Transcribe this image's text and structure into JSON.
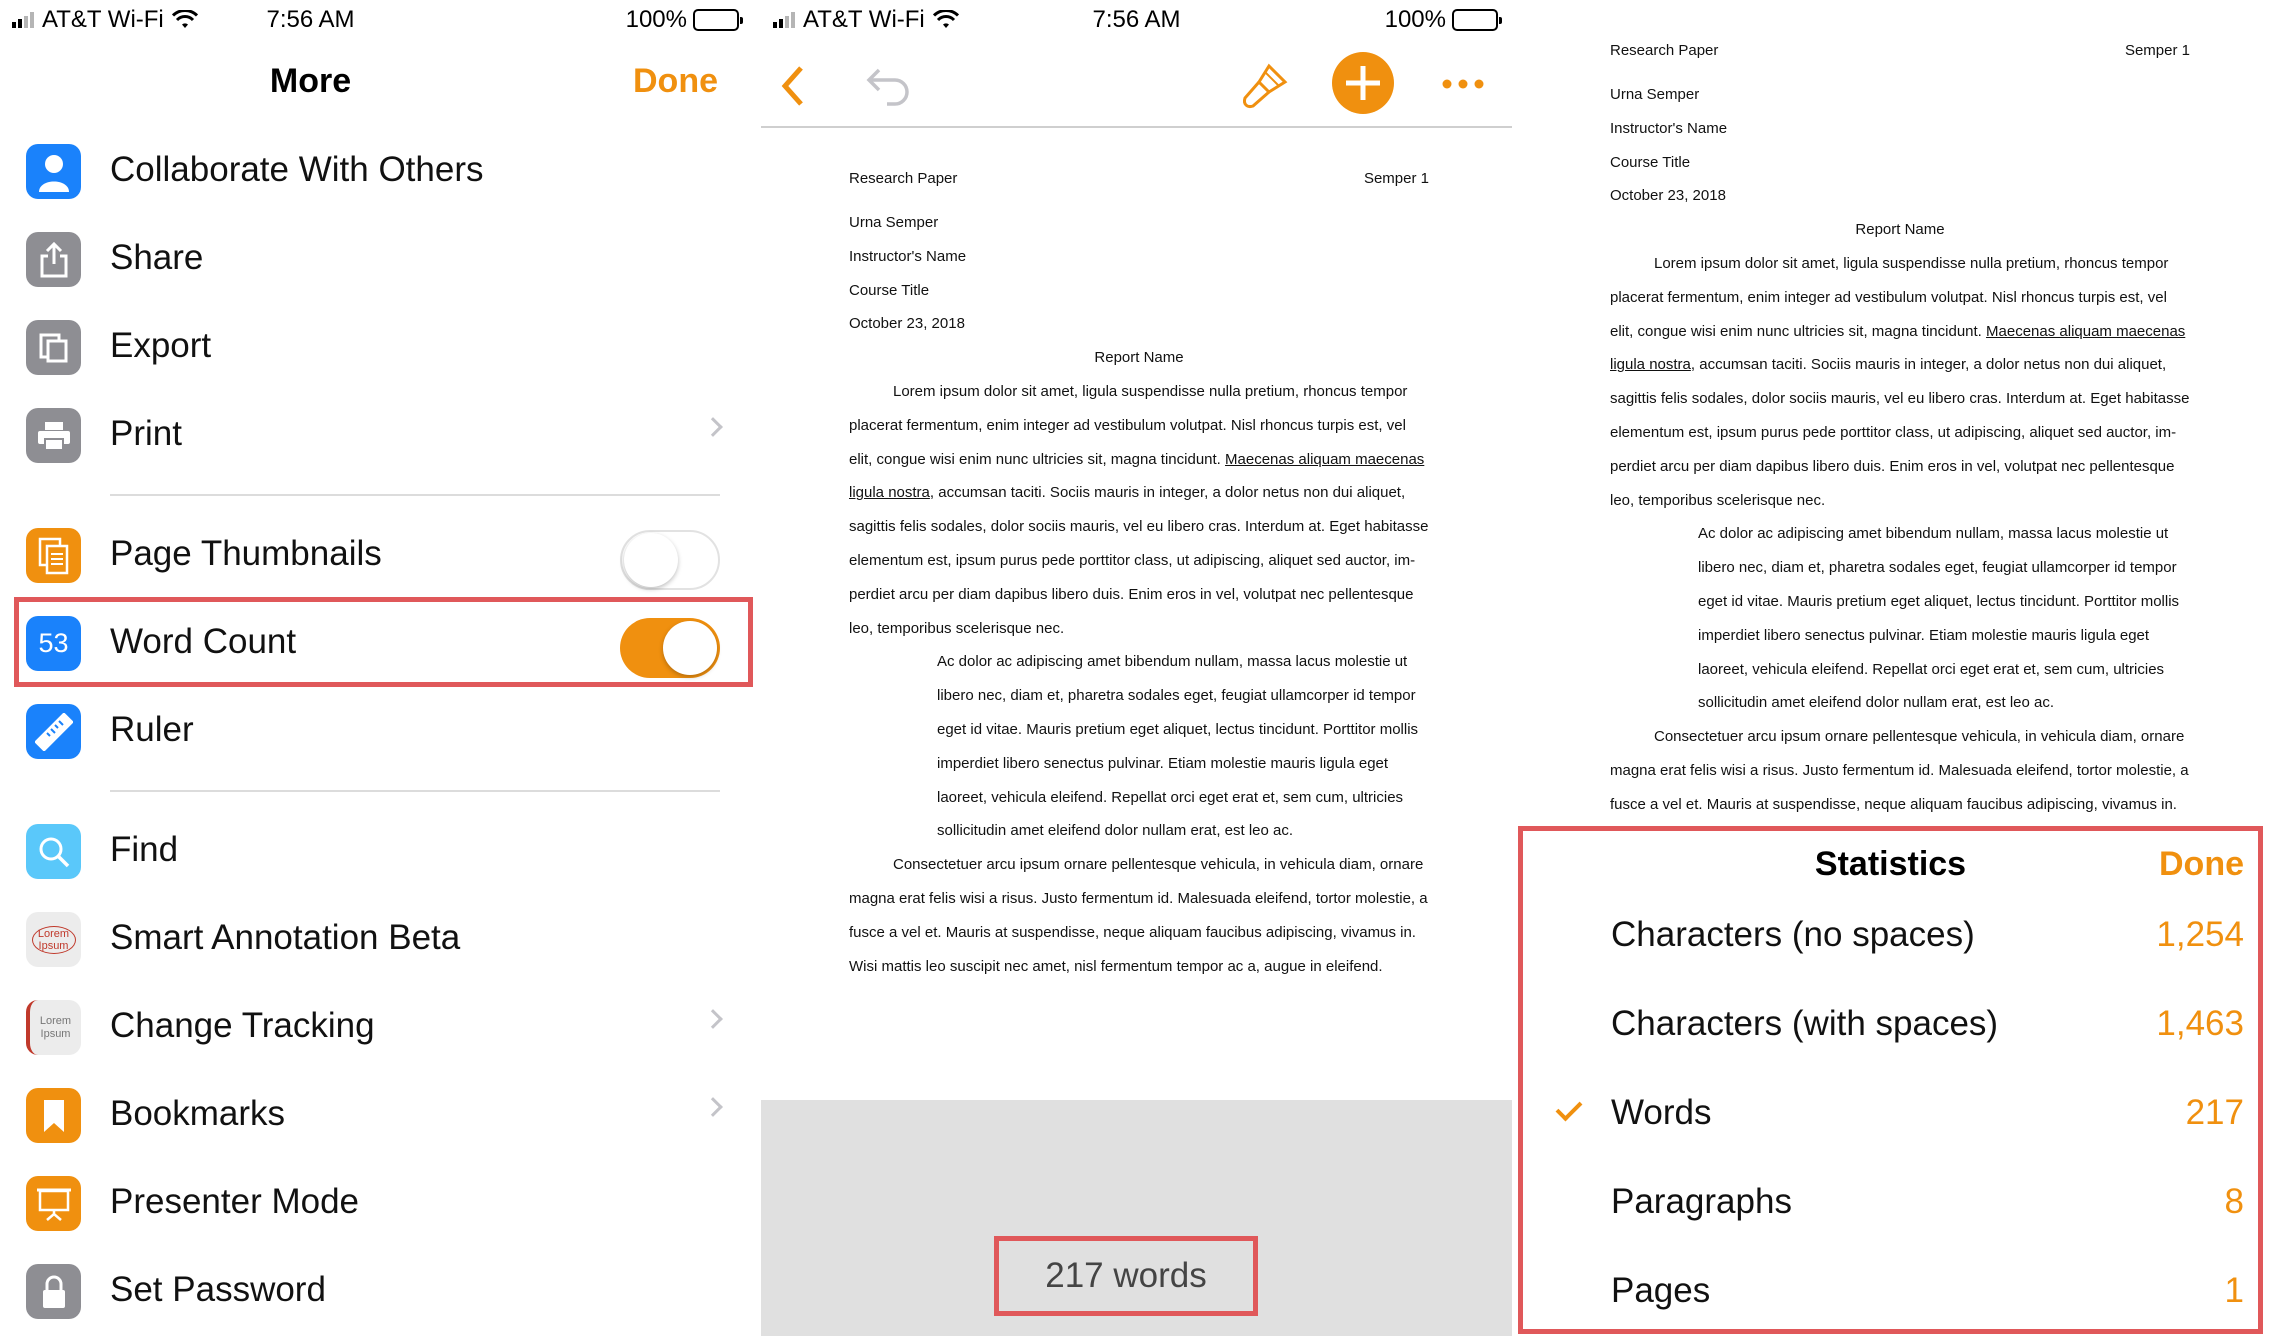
{
  "status_bar": {
    "carrier": "AT&T Wi-Fi",
    "time": "7:56 AM",
    "battery": "100%"
  },
  "more_menu": {
    "title": "More",
    "done_label": "Done",
    "items": [
      {
        "label": "Collaborate With Others",
        "icon": "person-icon"
      },
      {
        "label": "Share",
        "icon": "share-icon"
      },
      {
        "label": "Export",
        "icon": "export-icon"
      },
      {
        "label": "Print",
        "icon": "printer-icon"
      },
      {
        "label": "Page Thumbnails",
        "icon": "thumbnails-icon",
        "toggle": false
      },
      {
        "label": "Word Count",
        "icon": "word-count-icon",
        "icon_text": "53",
        "toggle": true
      },
      {
        "label": "Ruler",
        "icon": "ruler-icon"
      },
      {
        "label": "Find",
        "icon": "search-icon"
      },
      {
        "label": "Smart Annotation Beta",
        "icon": "annotation-icon",
        "icon_text": "Lorem Ipsum"
      },
      {
        "label": "Change Tracking",
        "icon": "change-tracking-icon",
        "icon_text": "Lorem Ipsum"
      },
      {
        "label": "Bookmarks",
        "icon": "bookmark-icon"
      },
      {
        "label": "Presenter Mode",
        "icon": "presenter-icon"
      },
      {
        "label": "Set Password",
        "icon": "lock-icon"
      }
    ]
  },
  "document": {
    "header_left": "Research Paper",
    "header_right": "Semper 1",
    "author": "Urna Semper",
    "instructor": "Instructor's Name",
    "course": "Course Title",
    "date": "October 23, 2018",
    "report_title": "Report Name",
    "p1": [
      "Lorem ipsum dolor sit amet, ligula suspendisse nulla pretium, rhoncus tempor",
      "placerat fermentum, enim integer ad vestibulum volutpat. Nisl rhoncus turpis est, vel",
      "elit, congue wisi enim nunc ultricies sit, magna tincidunt. Maecenas aliquam maecenas",
      "ligula nostra, accumsan taciti. Sociis mauris in integer, a dolor netus non dui aliquet,",
      "sagittis felis sodales, dolor sociis mauris, vel eu libero cras. Interdum at. Eget habitasse",
      "elementum est, ipsum purus pede porttitor class, ut adipiscing, aliquet sed auctor, im-",
      "perdiet arcu per diam dapibus libero duis. Enim eros in vel, volutpat nec pellentesque",
      "leo, temporibus scelerisque nec."
    ],
    "quote": [
      "Ac dolor ac adipiscing amet bibendum nullam, massa lacus molestie ut",
      "libero nec, diam et, pharetra sodales eget, feugiat ullamcorper id tempor",
      "eget id vitae. Mauris pretium eget aliquet, lectus tincidunt. Porttitor mollis",
      "imperdiet libero senectus pulvinar. Etiam molestie mauris ligula eget",
      "laoreet, vehicula eleifend. Repellat orci eget erat et, sem cum, ultricies",
      "sollicitudin amet eleifend dolor nullam erat, est leo ac."
    ],
    "p2": [
      "Consectetuer arcu ipsum ornare pellentesque vehicula, in vehicula diam, ornare",
      "magna erat felis wisi a risus. Justo fermentum id. Malesuada eleifend, tortor molestie, a",
      "fusce a vel et. Mauris at suspendisse, neque aliquam faucibus adipiscing, vivamus in.",
      "Wisi mattis leo suscipit nec amet, nisl fermentum tempor ac a, augue in eleifend."
    ],
    "word_count_label": "217 words"
  },
  "statistics": {
    "title": "Statistics",
    "done_label": "Done",
    "rows": [
      {
        "name": "Characters (no spaces)",
        "value": "1,254",
        "checked": false
      },
      {
        "name": "Characters (with spaces)",
        "value": "1,463",
        "checked": false
      },
      {
        "name": "Words",
        "value": "217",
        "checked": true
      },
      {
        "name": "Paragraphs",
        "value": "8",
        "checked": false
      },
      {
        "name": "Pages",
        "value": "1",
        "checked": false
      }
    ]
  },
  "colors": {
    "accent": "#f0900f",
    "highlight": "#e0585a",
    "blue": "#1a82fb",
    "gray_icon": "#8e8e93"
  }
}
